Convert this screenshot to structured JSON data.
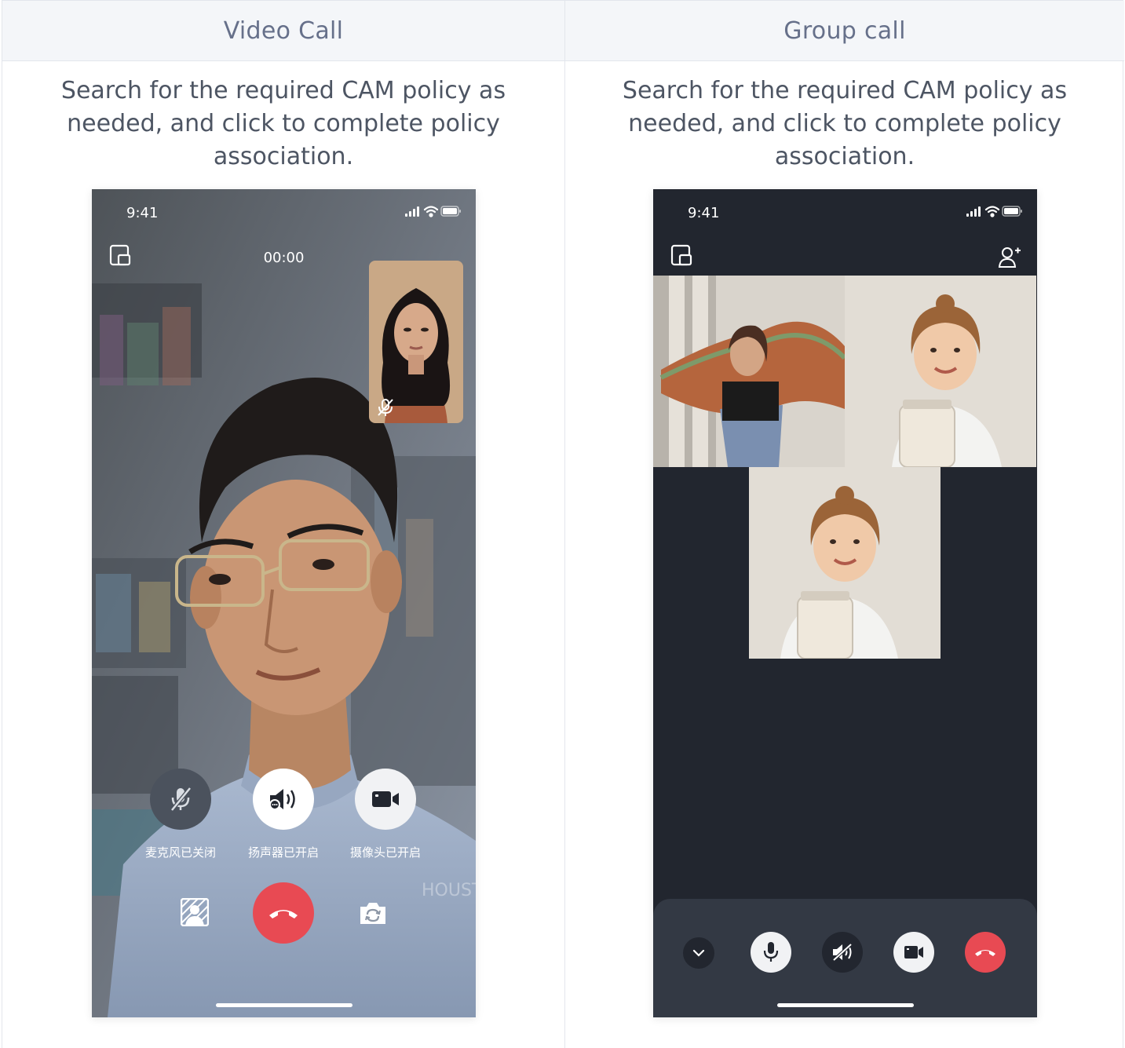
{
  "columns": [
    {
      "header": "Video Call",
      "description": "Search for the required CAM policy as needed, and click to complete policy association.",
      "phone": {
        "time": "9:41",
        "timer": "00:00",
        "controls": {
          "mic_label": "麦克风已关闭",
          "speaker_label": "扬声器已开启",
          "camera_label": "摄像头已开启"
        }
      }
    },
    {
      "header": "Group call",
      "description": "Search for the required CAM policy as needed, and click to complete policy association.",
      "phone": {
        "time": "9:41"
      }
    }
  ],
  "colors": {
    "hangup": "#e84a53",
    "dark_bg": "#22262f",
    "dock_bg": "#333944",
    "header_bg": "#f4f6f9"
  }
}
